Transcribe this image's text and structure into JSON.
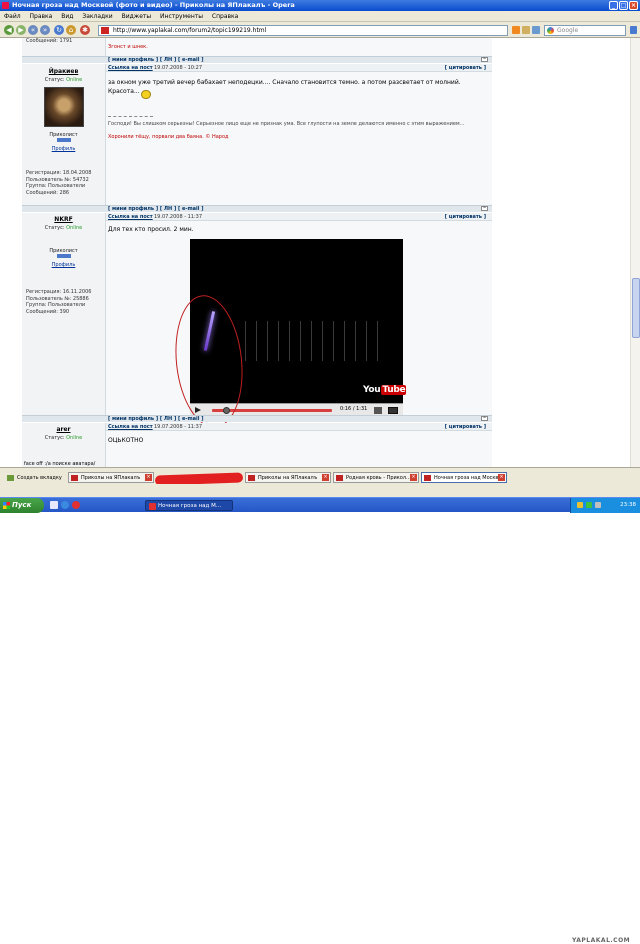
{
  "window": {
    "title": "Ночная гроза над Москвой (фото и видео) - Приколы на ЯПлакалъ - Opera"
  },
  "menu": [
    "Файл",
    "Правка",
    "Вид",
    "Закладки",
    "Виджеты",
    "Инструменты",
    "Справка"
  ],
  "address": {
    "url": "http://www.yaplakal.com/forum2/topic199219.html",
    "search_placeholder": "Google"
  },
  "top_post": {
    "messages": "Сообщений: 1791",
    "signature": "Згонст и шнек."
  },
  "bars": {
    "links": "[ мини профиль ] [ ЛН ] [ e-mail ]",
    "up": "^"
  },
  "post1": {
    "link": "Ссылка на пост",
    "date": "19.07.2008 - 10:27",
    "quote": "[ цитировать ]",
    "user": "Йракиев",
    "status_label": "Статус:",
    "status": "Online",
    "rank": "Приколист",
    "profile": "Профиль",
    "stats": [
      "Регистрация: 18.04.2008",
      "Пользователь №: 54732",
      "Группа: Пользователи",
      "Сообщений: 286"
    ],
    "text": "за окном уже третий вечер бабахает неподецки.... Сначало становится темно. а потом разсветает от молний. Красота...",
    "sig1": "Господи! Вы слишком серьезны! Серьезное лицо еще не признак ума. Все глупости на земле делаются именно с этим выражением...",
    "sig2": "Хоронили тёщу, порвали два баяна. © Народ"
  },
  "post2": {
    "link": "Ссылка на пост",
    "date": "19.07.2008 - 11:37",
    "quote": "[ цитировать ]",
    "user": "NKRF",
    "status_label": "Статус:",
    "status": "Online",
    "rank": "Приколист",
    "profile": "Профиль",
    "stats": [
      "Регистрация: 16.11.2006",
      "Пользователь №: 25886",
      "Группа: Пользователи",
      "Сообщений: 390"
    ],
    "text": "Для тех кто просил. 2 мин.",
    "video": {
      "logo_a": "You",
      "logo_b": "Tube",
      "time": "0:16 / 1:31",
      "progress": 0.12
    }
  },
  "post3": {
    "link": "Ссылка на пост",
    "date": "19.07.2008 - 11:37",
    "quote": "[ цитировать ]",
    "user": "arer",
    "status_label": "Статус:",
    "status": "Online",
    "text": "ОЦЬКОТНО",
    "footer": "face off :/a поиске аватара/"
  },
  "tabs": [
    "Создать вкладку",
    "Приколы на ЯПлакалъ",
    "Приколы на ЯПлакалъ",
    "Родная кровь - Прикол...",
    "Ночная гроза над Москв..."
  ],
  "site_logo": "YAPLAKAL.COM",
  "taskbar": {
    "start": "Пуск",
    "task": "Ночная гроза над М...",
    "clock": "23:38"
  }
}
